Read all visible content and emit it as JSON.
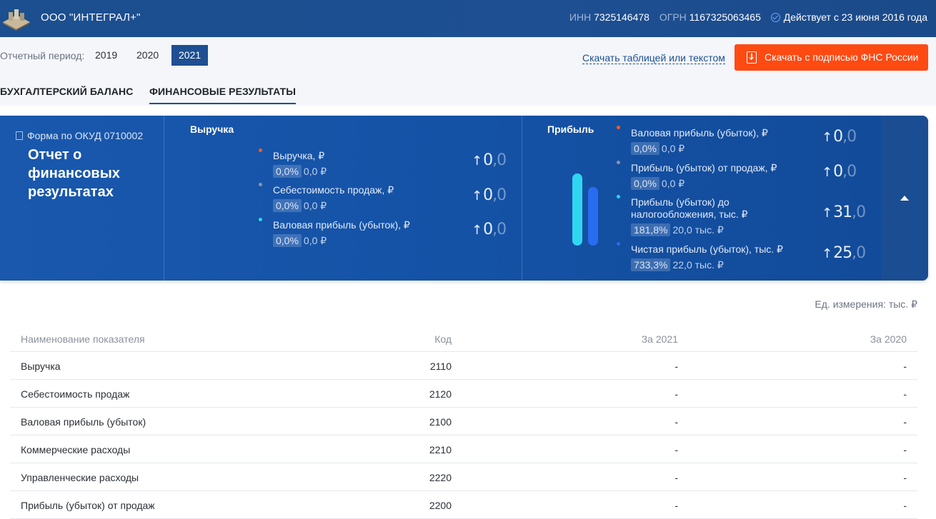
{
  "header": {
    "company": "ООО \"ИНТЕГРАЛ+\"",
    "inn_label": "ИНН",
    "inn": "7325146478",
    "ogrn_label": "ОГРН",
    "ogrn": "1167325063465",
    "status": "Действует с 23 июня 2016 года"
  },
  "period": {
    "label": "Отчетный период:",
    "years": [
      "2019",
      "2020",
      "2021"
    ],
    "selected": "2021"
  },
  "downloads": {
    "text_link": "Скачать таблицей или текстом",
    "signed_button": "Скачать с подписью ФНС России"
  },
  "tabs": [
    "БУХГАЛТЕРСКИЙ БАЛАНС",
    "ФИНАНСОВЫЕ РЕЗУЛЬТАТЫ"
  ],
  "active_tab": "ФИНАНСОВЫЕ РЕЗУЛЬТАТЫ",
  "summary": {
    "form_code": "Форма по ОКУД 0710002",
    "form_title": "Отчет о финансовых результатах",
    "revenue_section": {
      "title": "Выручка",
      "items": [
        {
          "name": "Выручка, ₽",
          "pct": "0,0%",
          "prev": "0,0 ₽",
          "value_int": "0",
          "value_frac": ",0",
          "dot_color": "#ff5a1f"
        },
        {
          "name": "Себестоимость продаж, ₽",
          "pct": "0,0%",
          "prev": "0,0 ₽",
          "value_int": "0",
          "value_frac": ",0",
          "dot_color": "#8b93a6"
        },
        {
          "name": "Валовая прибыль (убыток), ₽",
          "pct": "0,0%",
          "prev": "0,0 ₽",
          "value_int": "0",
          "value_frac": ",0",
          "dot_color": "#2fd6f0"
        }
      ]
    },
    "profit_section": {
      "title": "Прибыль",
      "items": [
        {
          "name": "Валовая прибыль (убыток), ₽",
          "pct": "0,0%",
          "prev": "0,0 ₽",
          "value_int": "0",
          "value_frac": ",0",
          "dot_color": "#ff5a1f"
        },
        {
          "name": "Прибыль (убыток) от продаж, ₽",
          "pct": "0,0%",
          "prev": "0,0 ₽",
          "value_int": "0",
          "value_frac": ",0",
          "dot_color": "#8b93a6"
        },
        {
          "name": "Прибыль (убыток) до налогообложения, тыс. ₽",
          "pct": "181,8%",
          "prev": "20,0 тыс. ₽",
          "value_int": "31",
          "value_frac": ",0",
          "dot_color": "#2fd6f0"
        },
        {
          "name": "Чистая прибыль (убыток), тыс. ₽",
          "pct": "733,3%",
          "prev": "22,0 тыс. ₽",
          "value_int": "25",
          "value_frac": ",0",
          "dot_color": "#2a6cf0"
        }
      ]
    }
  },
  "table": {
    "units": "Ед. измерения: тыс. ₽",
    "headers": [
      "Наименование показателя",
      "Код",
      "За 2021",
      "За 2020"
    ],
    "rows": [
      [
        "Выручка",
        "2110",
        "-",
        "-"
      ],
      [
        "Себестоимость продаж",
        "2120",
        "-",
        "-"
      ],
      [
        "Валовая прибыль (убыток)",
        "2100",
        "-",
        "-"
      ],
      [
        "Коммерческие расходы",
        "2210",
        "-",
        "-"
      ],
      [
        "Управленческие расходы",
        "2220",
        "-",
        "-"
      ],
      [
        "Прибыль (убыток) от продаж",
        "2200",
        "-",
        "-"
      ]
    ]
  }
}
